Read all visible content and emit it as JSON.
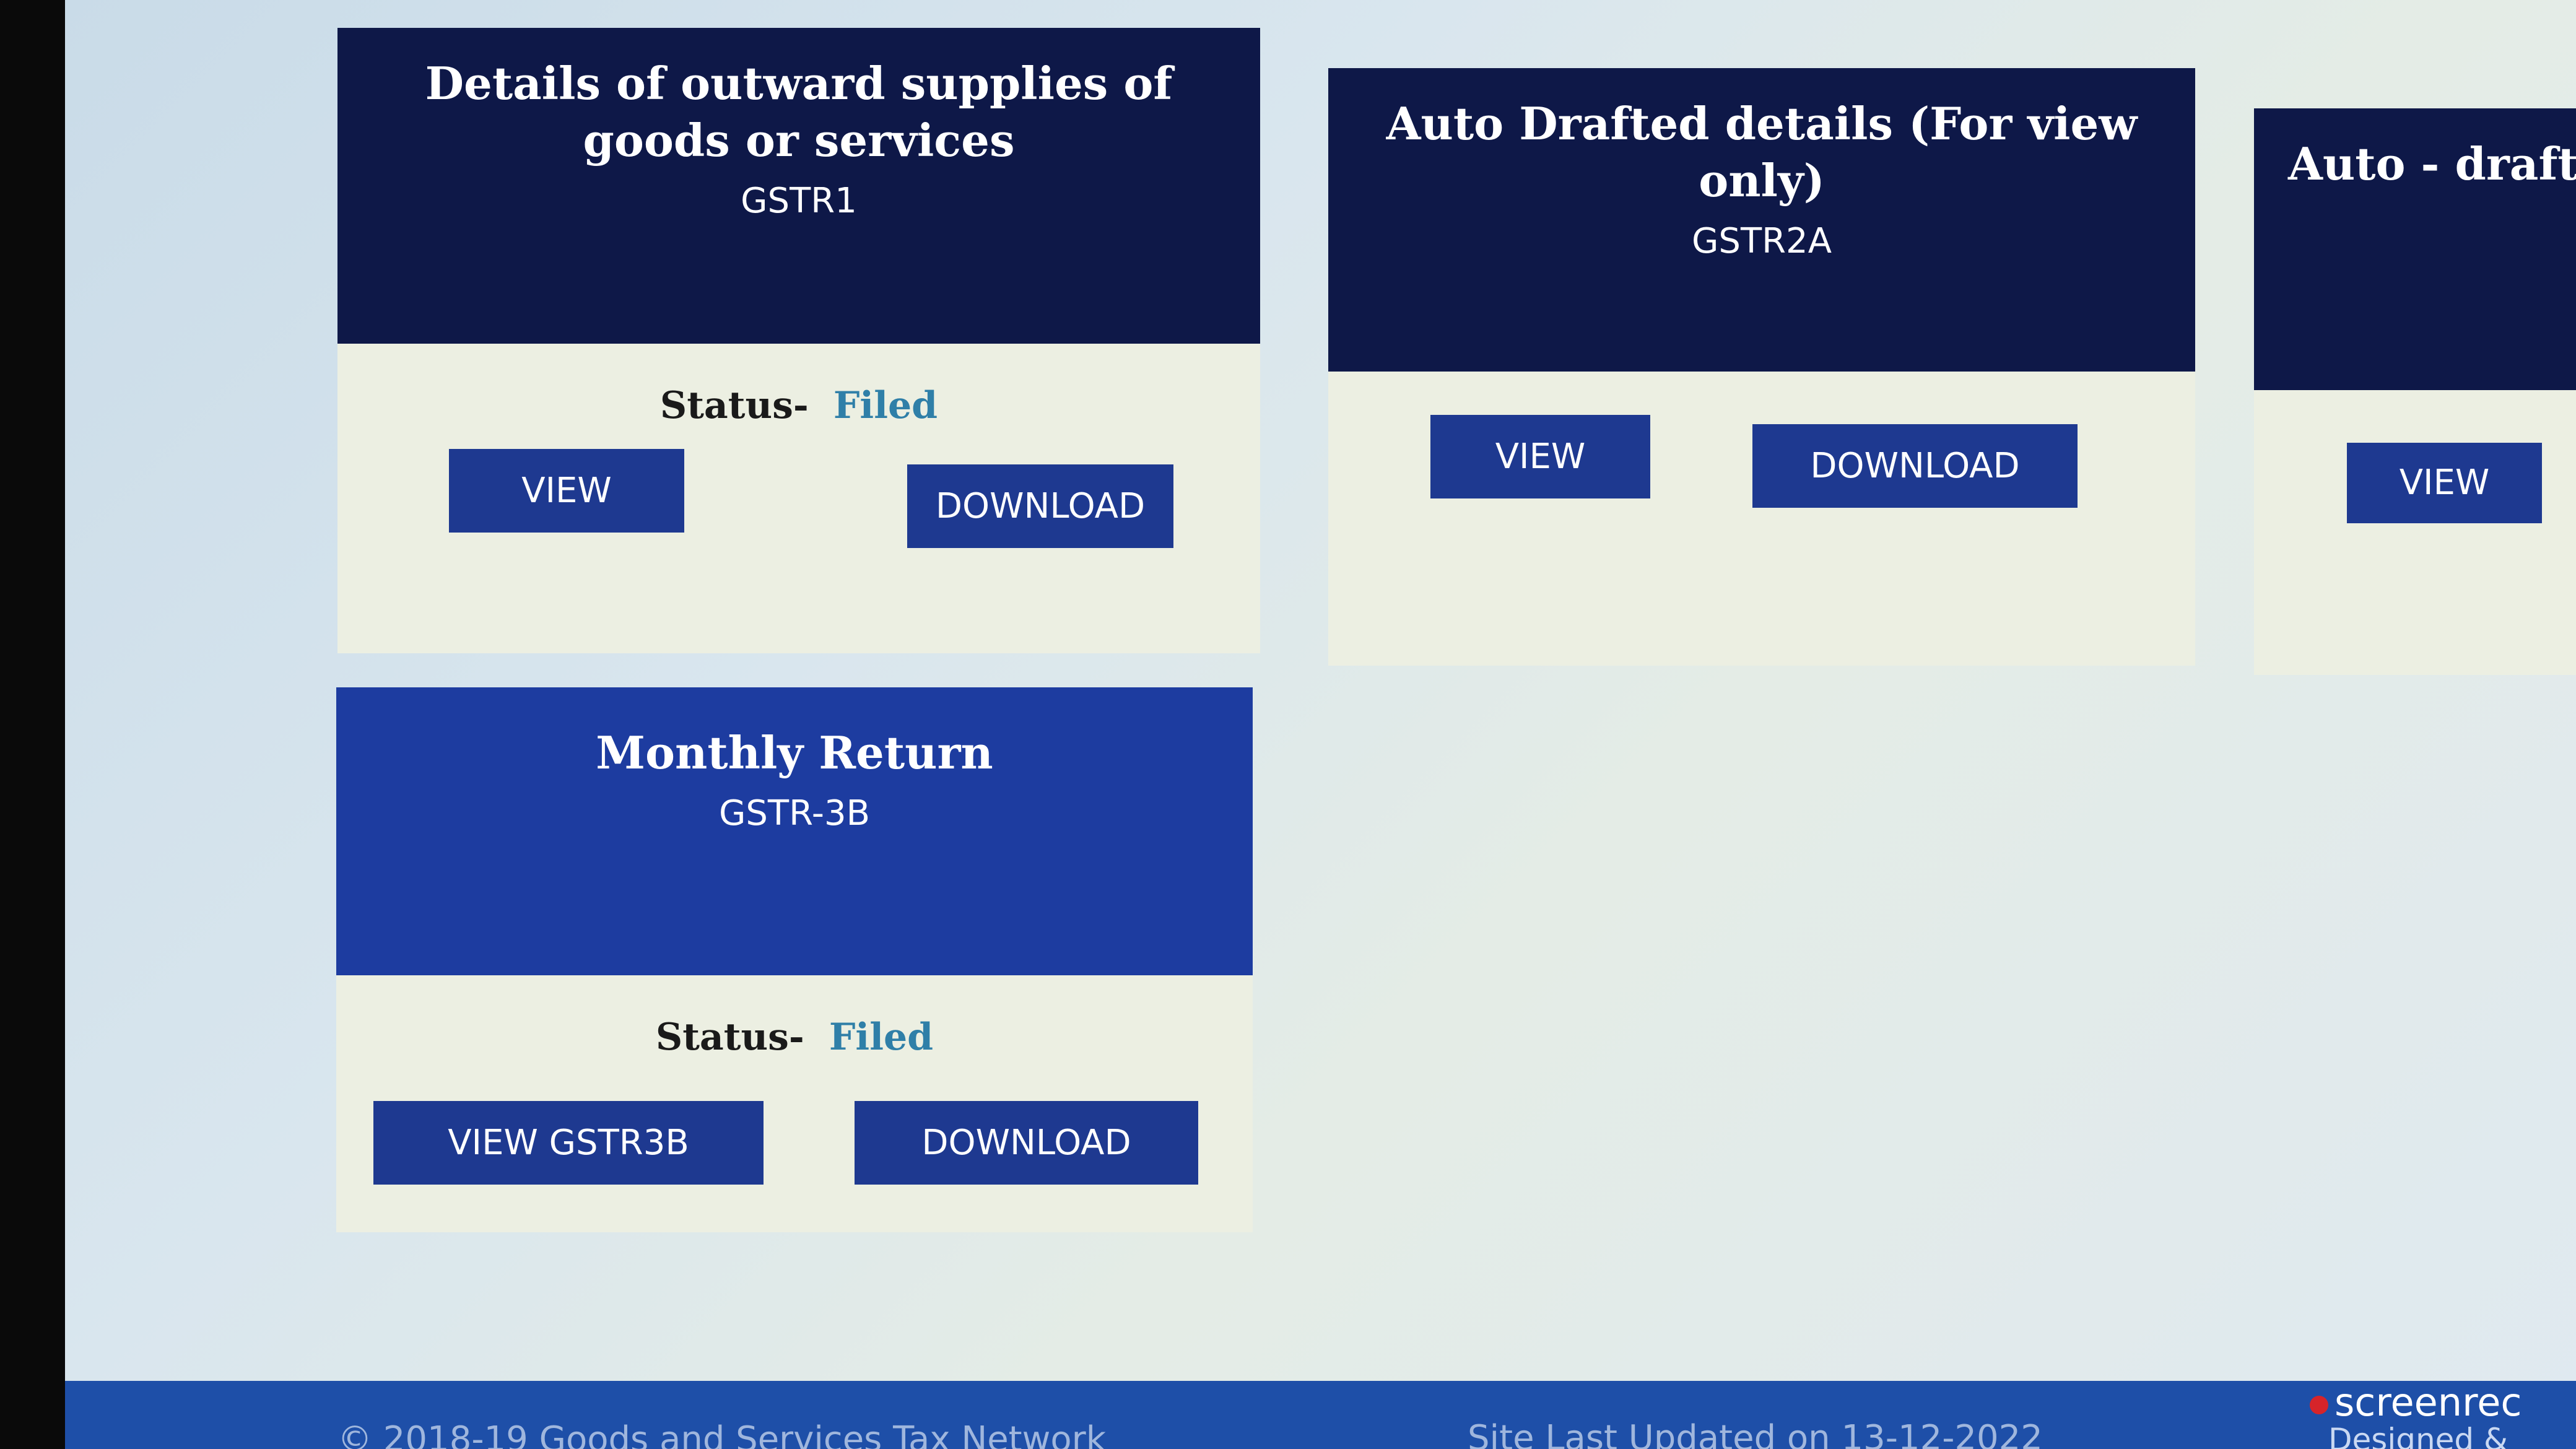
{
  "tiles": [
    {
      "title": "Details of outward supplies of goods or services",
      "code": "GSTR1",
      "status_label": "Status-",
      "status_value": "Filed",
      "buttons": [
        "VIEW",
        "DOWNLOAD"
      ]
    },
    {
      "title": "Auto Drafted details (For view only)",
      "code": "GSTR2A",
      "buttons": [
        "VIEW",
        "DOWNLOAD"
      ]
    },
    {
      "title": "Auto - drafted",
      "buttons": [
        "VIEW"
      ]
    },
    {
      "title": "Monthly Return",
      "code": "GSTR-3B",
      "status_label": "Status-",
      "status_value": "Filed",
      "buttons": [
        "VIEW GSTR3B",
        "DOWNLOAD"
      ]
    }
  ],
  "footer": {
    "copyright": "© 2018-19 Goods and Services Tax Network",
    "last_updated": "Site Last Updated on 13-12-2022",
    "credit": "Designed & Dev"
  },
  "recorder_badge": {
    "text": "screenrec"
  },
  "colors": {
    "tile_header_dark": "#0e1848",
    "tile_header_blue": "#1d3ca0",
    "button": "#1e3990",
    "status_filed": "#2f7fa8",
    "footer": "#1e4fa8"
  }
}
